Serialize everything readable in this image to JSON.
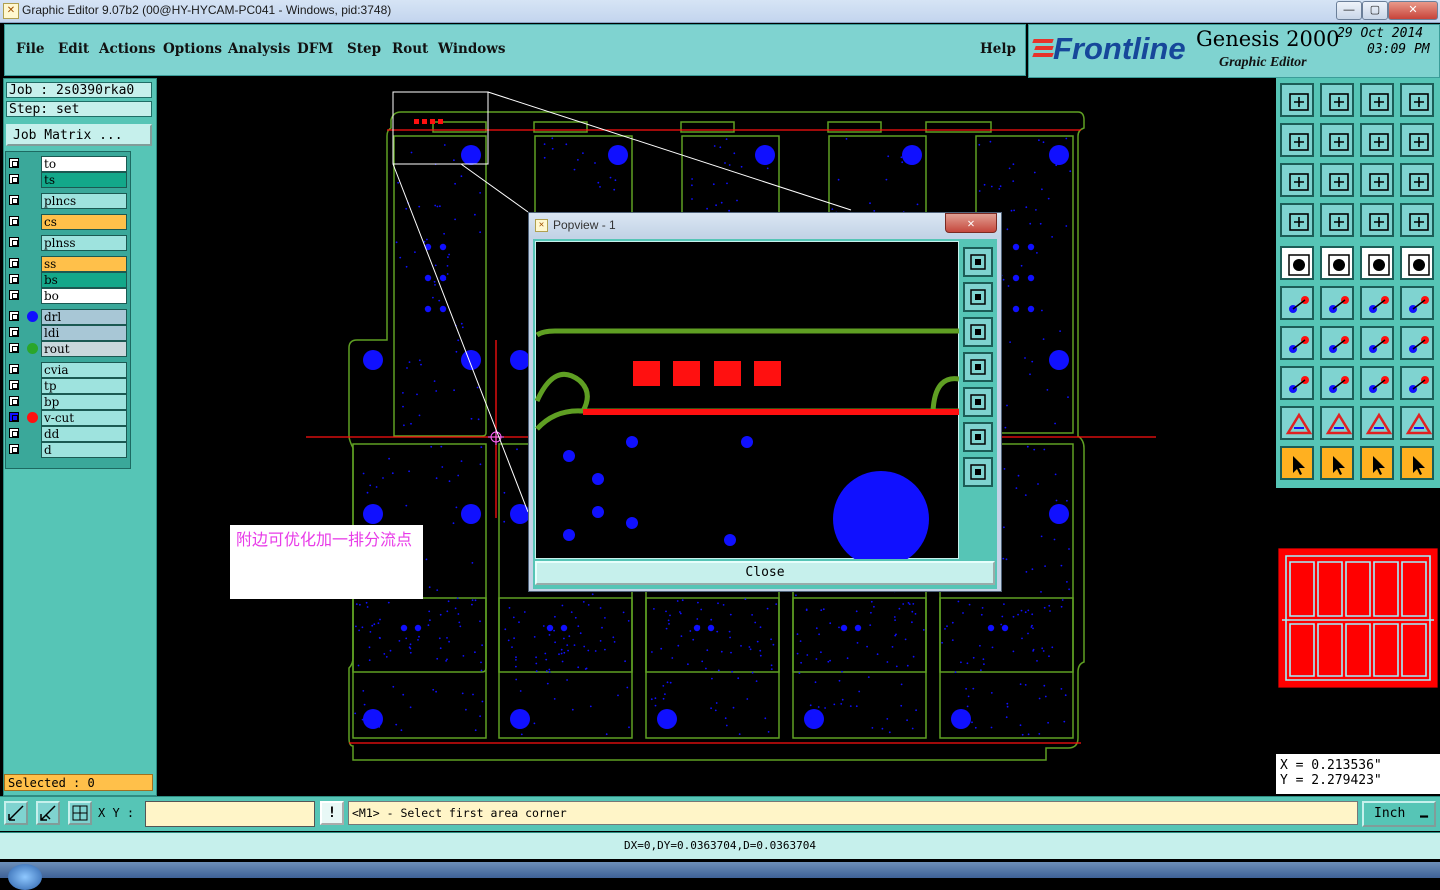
{
  "window": {
    "title": "Graphic Editor 9.07b2 (00@HY-HYCAM-PC041 - Windows, pid:3748)",
    "minimize": "—",
    "maximize": "▢",
    "close": "✕"
  },
  "menu": {
    "items": [
      "File",
      "Edit",
      "Actions",
      "Options",
      "Analysis",
      "DFM",
      "Step",
      "Rout",
      "Windows"
    ],
    "help": "Help"
  },
  "brand": {
    "logo": "Frontline",
    "product": "Genesis 2000",
    "subtitle": "Graphic Editor",
    "date": "29 Oct 2014",
    "time": "03:09 PM"
  },
  "job": {
    "job_line": "Job : 2s0390rka0",
    "step_line": "Step: set",
    "matrix_button": "Job Matrix ..."
  },
  "layers": [
    {
      "name": "to",
      "color": "#ffffff",
      "dot": ""
    },
    {
      "name": "ts",
      "color": "#13a88a",
      "dot": ""
    },
    {
      "name": "plncs",
      "color": "#9ee3de",
      "dot": ""
    },
    {
      "name": "cs",
      "color": "#ffc04a",
      "dot": ""
    },
    {
      "name": "plnss",
      "color": "#9ee3de",
      "dot": ""
    },
    {
      "name": "ss",
      "color": "#ffc04a",
      "dot": ""
    },
    {
      "name": "bs",
      "color": "#13a88a",
      "dot": ""
    },
    {
      "name": "bo",
      "color": "#ffffff",
      "dot": ""
    },
    {
      "name": "drl",
      "color": "#a8c7d6",
      "dot": "#1010ff"
    },
    {
      "name": "ldi",
      "color": "#a8c7d6",
      "dot": ""
    },
    {
      "name": "rout",
      "color": "#c9d8dc",
      "dot": "#2aa62a"
    },
    {
      "name": "cvia",
      "color": "#9ee3de",
      "dot": ""
    },
    {
      "name": "tp",
      "color": "#9ee3de",
      "dot": ""
    },
    {
      "name": "bp",
      "color": "#9ee3de",
      "dot": ""
    },
    {
      "name": "v-cut",
      "color": "#9ee3de",
      "dot": "#ff1010"
    },
    {
      "name": "dd",
      "color": "#9ee3de",
      "dot": ""
    },
    {
      "name": "d",
      "color": "#9ee3de",
      "dot": ""
    }
  ],
  "selected": "Selected : 0",
  "annotation": "附边可优化加一排分流点",
  "popview": {
    "title": "Popview - 1",
    "close_label": "Close",
    "close_x": "✕"
  },
  "coords": {
    "x": "X = 0.213536\"",
    "y": "Y = 2.279423\""
  },
  "bottombar": {
    "xy_label": "X Y :",
    "xy_value": "",
    "warn": "!",
    "prompt": "<M1> - Select first area corner",
    "units": "Inch"
  },
  "status": "DX=0,DY=0.0363704,D=0.0363704",
  "colors": {
    "panel": "#56c5b6",
    "menu": "#7fd3d0",
    "outline": "#5f9f23",
    "drill": "#1010ff",
    "vcut": "#ff1010"
  }
}
